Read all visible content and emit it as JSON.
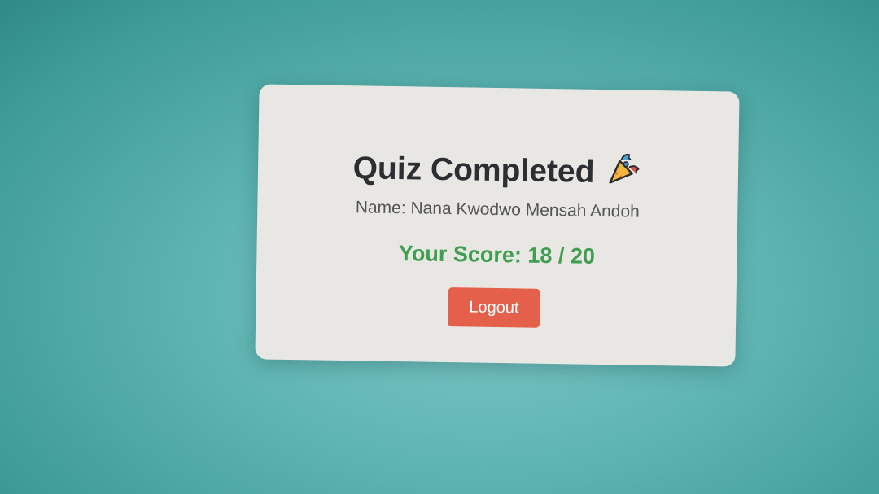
{
  "card": {
    "title": "Quiz Completed",
    "title_icon": "party-popper-icon",
    "name_line": "Name: Nana Kwodwo Mensah Andoh",
    "score_line": "Your Score: 18 / 20",
    "logout_label": "Logout"
  },
  "colors": {
    "score": "#3f9e4f",
    "button": "#e4604a",
    "background": "#5fb5b3"
  }
}
